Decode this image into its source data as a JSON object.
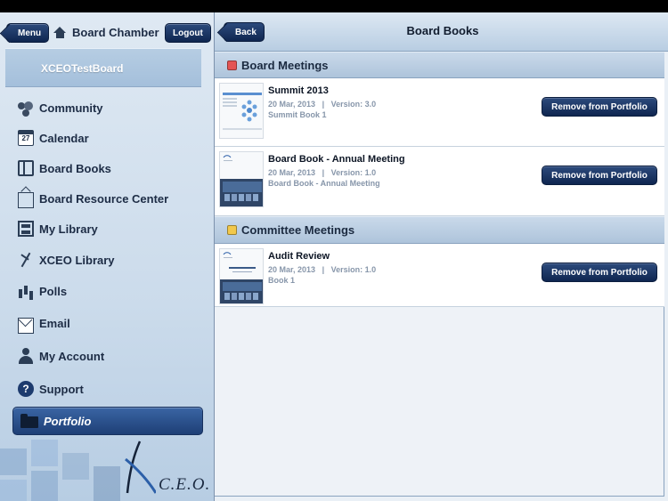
{
  "sidebar": {
    "menu_label": "Menu",
    "home_label": "Board Chamber",
    "logout_label": "Logout",
    "board_name": "XCEOTestBoard",
    "items": [
      {
        "label": "Community",
        "icon": "community-icon"
      },
      {
        "label": "Calendar",
        "icon": "calendar-icon",
        "badge": "27"
      },
      {
        "label": "Board Books",
        "icon": "book-icon"
      },
      {
        "label": "Board Resource Center",
        "icon": "resource-icon"
      },
      {
        "label": "My Library",
        "icon": "library-icon"
      },
      {
        "label": "XCEO Library",
        "icon": "xceo-icon"
      },
      {
        "label": "Polls",
        "icon": "polls-icon"
      },
      {
        "label": "Email",
        "icon": "email-icon"
      },
      {
        "label": "My Account",
        "icon": "account-icon"
      },
      {
        "label": "Support",
        "icon": "support-icon",
        "glyph": "?"
      }
    ],
    "active_item": {
      "label": "Portfolio",
      "icon": "folder-icon"
    },
    "logo_text": "C.E.O."
  },
  "main": {
    "back_label": "Back",
    "title": "Board Books",
    "sections": [
      {
        "title": "Board Meetings",
        "color": "#e45454",
        "items": [
          {
            "title": "Summit 2013",
            "date": "20 Mar, 2013",
            "separator": "|",
            "version": "Version: 3.0",
            "subtitle": "Summit Book 1",
            "action": "Remove from Portfolio"
          },
          {
            "title": "Board Book - Annual Meeting",
            "date": "20 Mar, 2013",
            "separator": "|",
            "version": "Version: 1.0",
            "subtitle": "Board Book - Annual Meeting",
            "action": "Remove from Portfolio"
          }
        ]
      },
      {
        "title": "Committee Meetings",
        "color": "#f2c84b",
        "items": [
          {
            "title": "Audit Review",
            "date": "20 Mar, 2013",
            "separator": "|",
            "version": "Version: 1.0",
            "subtitle": "Book 1",
            "action": "Remove from Portfolio"
          }
        ]
      }
    ]
  }
}
